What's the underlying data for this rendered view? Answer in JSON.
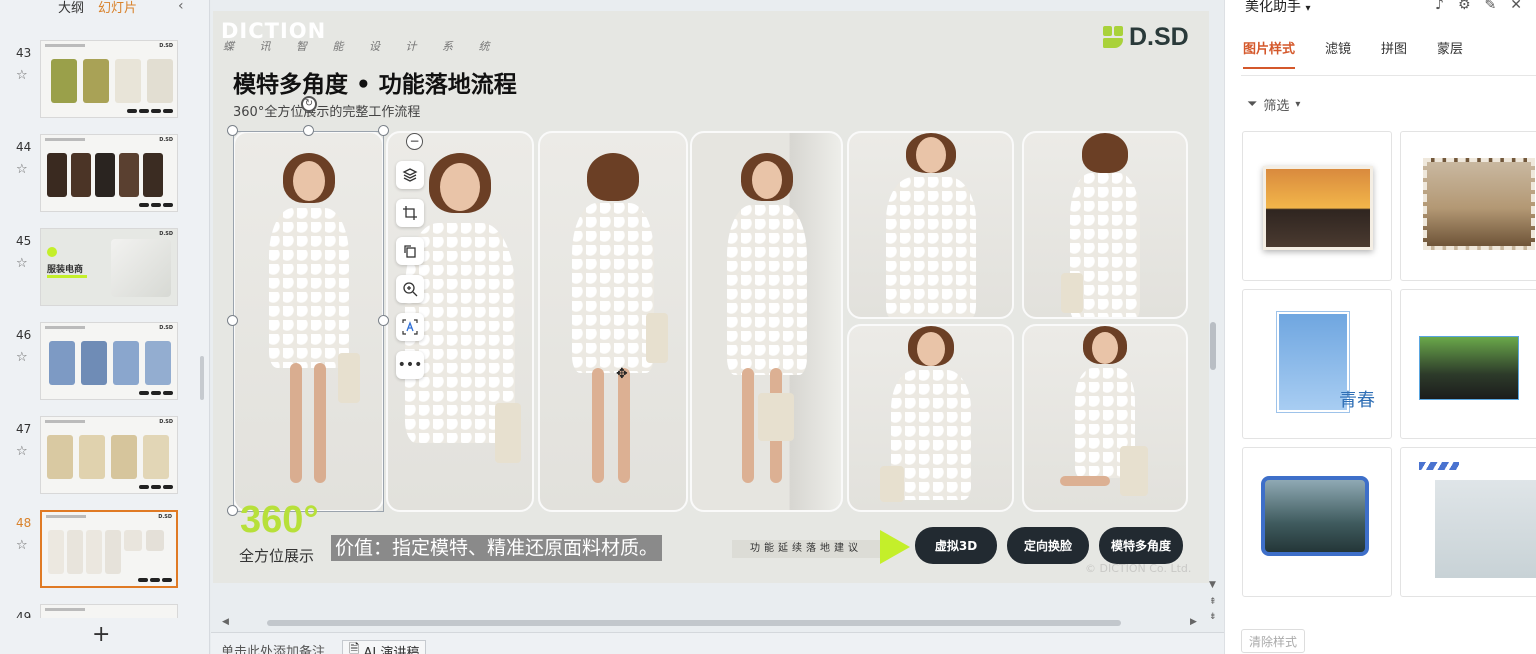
{
  "left_panel": {
    "tabs": [
      {
        "label": "大纲",
        "active": false
      },
      {
        "label": "幻灯片",
        "active": true
      }
    ],
    "slides": [
      {
        "number": "43",
        "active": false
      },
      {
        "number": "44",
        "active": false
      },
      {
        "number": "45",
        "active": false,
        "tag": "服装电商"
      },
      {
        "number": "46",
        "active": false
      },
      {
        "number": "47",
        "active": false
      },
      {
        "number": "48",
        "active": true
      }
    ],
    "partial_slide_number": "49",
    "add_label": "+"
  },
  "slide": {
    "brand": "DICTION",
    "brand_sub": "蝶 讯 智 能 设 计 系 统",
    "logo_text": "D.SD",
    "title": "模特多角度 • 功能落地流程",
    "subtitle": "360°全方位展示的完整工作流程",
    "big_number": "360°",
    "allround_label": "全方位展示",
    "value_text": "价值：指定模特、精准还原面料材质。",
    "func_text": "功能延续落地建议",
    "pills": [
      "虚拟3D",
      "定向换脸",
      "模特多角度"
    ],
    "copyright": "© DICTION Co. Ltd."
  },
  "toolbar_icons": [
    "layers-icon",
    "crop-icon",
    "replace-icon",
    "zoom-in-icon",
    "text-recognize-icon",
    "more-icon"
  ],
  "notes": {
    "placeholder": "单击此处添加备注",
    "ai_button": "AI 演讲稿"
  },
  "right_panel": {
    "title": "美化助手",
    "tabs": [
      {
        "label": "图片样式",
        "active": true
      },
      {
        "label": "滤镜",
        "active": false
      },
      {
        "label": "拼图",
        "active": false
      },
      {
        "label": "蒙层",
        "active": false
      }
    ],
    "filter_label": "筛选",
    "card_texts": {
      "youth": "青春"
    },
    "clear_button": "清除样式"
  },
  "colors": {
    "accent_orange": "#d4582b",
    "lime": "#b7e03a",
    "pill_dark": "#222a31"
  }
}
